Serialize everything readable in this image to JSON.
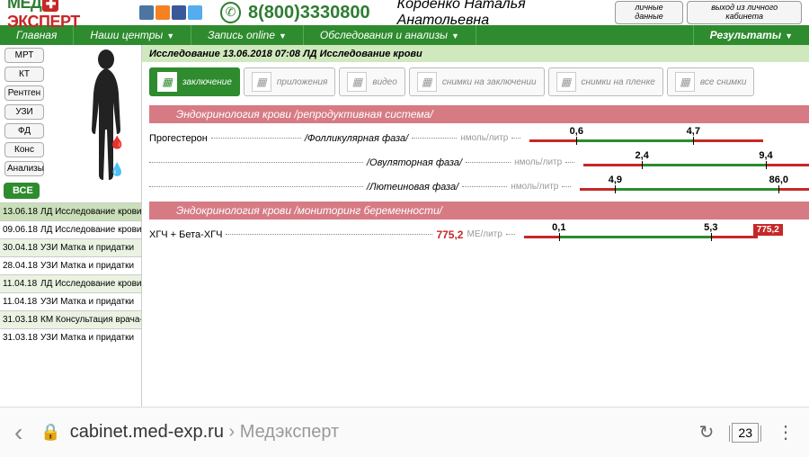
{
  "header": {
    "logo_med": "МЕД",
    "logo_plus": "✚",
    "logo_expert": "ЭКСПЕРТ",
    "phone": "8(800)3330800",
    "patient": "Корденко Наталья Анатольевна",
    "btn_personal": "личные данные",
    "btn_logout": "выход из личного кабинета"
  },
  "menu": {
    "items": [
      "Главная",
      "Наши центры",
      "Запись online",
      "Обследования и анализы"
    ],
    "results": "Результаты"
  },
  "filters": [
    "МРТ",
    "КТ",
    "Рентген",
    "УЗИ",
    "ФД",
    "Конс",
    "Анализы"
  ],
  "all_label": "ВСЕ",
  "visits": [
    {
      "date": "13.06.18",
      "title": "ЛД Исследование крови",
      "sel": true
    },
    {
      "date": "09.06.18",
      "title": "ЛД Исследование крови"
    },
    {
      "date": "30.04.18",
      "title": "УЗИ Матка и придатки",
      "alt": true
    },
    {
      "date": "28.04.18",
      "title": "УЗИ Матка и придатки"
    },
    {
      "date": "11.04.18",
      "title": "ЛД Исследование крови",
      "alt": true
    },
    {
      "date": "11.04.18",
      "title": "УЗИ Матка и придатки"
    },
    {
      "date": "31.03.18",
      "title": "КМ Консультация врача-г…",
      "alt": true
    },
    {
      "date": "31.03.18",
      "title": "УЗИ Матка и придатки"
    }
  ],
  "main_header": "Исследование 13.06.2018 07:08 ЛД Исследование крови",
  "tabs": [
    {
      "label": "заключение",
      "active": true
    },
    {
      "label": "приложения"
    },
    {
      "label": "видео"
    },
    {
      "label": "снимки на заключении"
    },
    {
      "label": "снимки на пленке"
    },
    {
      "label": "все снимки"
    }
  ],
  "section1": "Эндокринология крови /репродуктивная система/",
  "hormone1": "Прогестерон",
  "phases": [
    {
      "name": "/Фолликулярная фаза/",
      "unit": "нмоль/литр",
      "low": "0,6",
      "high": "4,7"
    },
    {
      "name": "/Овуляторная фаза/",
      "unit": "нмоль/литр",
      "low": "2,4",
      "high": "9,4"
    },
    {
      "name": "/Лютеиновая фаза/",
      "unit": "нмоль/литр",
      "low": "4,9",
      "high": "86,0"
    }
  ],
  "section2": "Эндокринология крови /мониторинг беременности/",
  "hcg": {
    "name": "ХГЧ + Бета-ХГЧ",
    "value": "775,2",
    "unit": "МЕ/литр",
    "low": "0,1",
    "high": "5,3",
    "badge": "775,2"
  },
  "browser": {
    "domain": "cabinet.med-exp.ru",
    "title": " › Медэксперт",
    "tabs": "23"
  }
}
